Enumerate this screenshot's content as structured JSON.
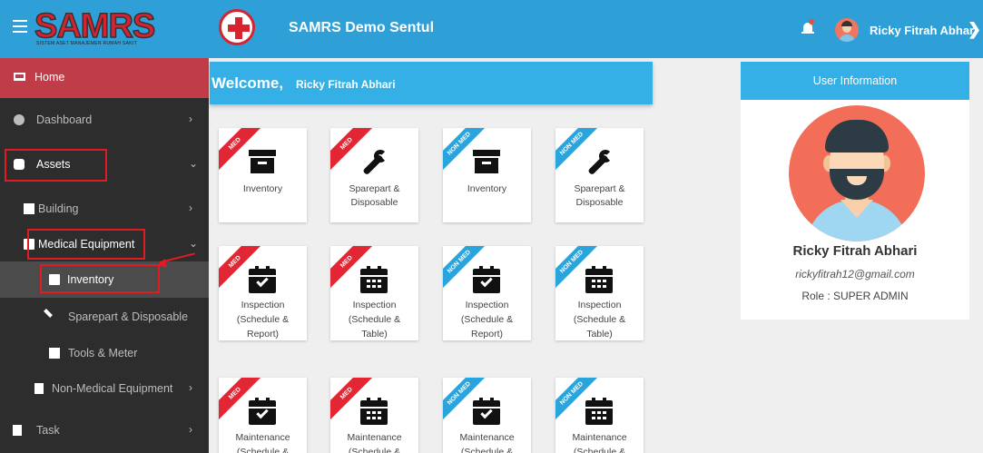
{
  "header": {
    "logo": "SAMRS",
    "logo_sub": "SISTEM ASET MANAJEMEN RUMAH SAKIT",
    "app_name": "SAMRS Demo Sentul",
    "user_name": "Ricky Fitrah Abhari",
    "chevron": "❯"
  },
  "sidebar": {
    "home": "Home",
    "dashboard": "Dashboard",
    "assets": "Assets",
    "building": "Building",
    "medical_equipment": "Medical Equipment",
    "inventory": "Inventory",
    "sparepart": "Sparepart & Disposable",
    "tools": "Tools & Meter",
    "non_medical": "Non-Medical Equipment",
    "task": "Task",
    "arrow_right": "›",
    "arrow_down": "⌄"
  },
  "welcome": {
    "greeting": "Welcome,",
    "name": "Ricky Fitrah Abhari"
  },
  "tiles": [
    {
      "badge": "MED",
      "line1": "Inventory",
      "line2": "",
      "line3": ""
    },
    {
      "badge": "MED",
      "line1": "Sparepart &",
      "line2": "Disposable",
      "line3": ""
    },
    {
      "badge": "NON MED",
      "line1": "Inventory",
      "line2": "",
      "line3": ""
    },
    {
      "badge": "NON MED",
      "line1": "Sparepart &",
      "line2": "Disposable",
      "line3": ""
    },
    {
      "badge": "MED",
      "line1": "Inspection",
      "line2": "(Schedule &",
      "line3": "Report)"
    },
    {
      "badge": "MED",
      "line1": "Inspection",
      "line2": "(Schedule &",
      "line3": "Table)"
    },
    {
      "badge": "NON MED",
      "line1": "Inspection",
      "line2": "(Schedule &",
      "line3": "Report)"
    },
    {
      "badge": "NON MED",
      "line1": "Inspection",
      "line2": "(Schedule &",
      "line3": "Table)"
    },
    {
      "badge": "MED",
      "line1": "Maintenance",
      "line2": "(Schedule &",
      "line3": ""
    },
    {
      "badge": "MED",
      "line1": "Maintenance",
      "line2": "(Schedule &",
      "line3": ""
    },
    {
      "badge": "NON MED",
      "line1": "Maintenance",
      "line2": "(Schedule &",
      "line3": ""
    },
    {
      "badge": "NON MED",
      "line1": "Maintenance",
      "line2": "(Schedule &",
      "line3": ""
    }
  ],
  "user_info": {
    "title": "User Information",
    "name": "Ricky Fitrah Abhari",
    "email": "rickyfitrah12@gmail.com",
    "role": "Role : SUPER ADMIN"
  },
  "colors": {
    "primary": "#35b0e7",
    "active_nav": "#c13c49",
    "sidebar": "#2d2d2d",
    "badge_med": "#e32633",
    "badge_non_med": "#2aa4dd",
    "annotation": "#e21b22"
  }
}
